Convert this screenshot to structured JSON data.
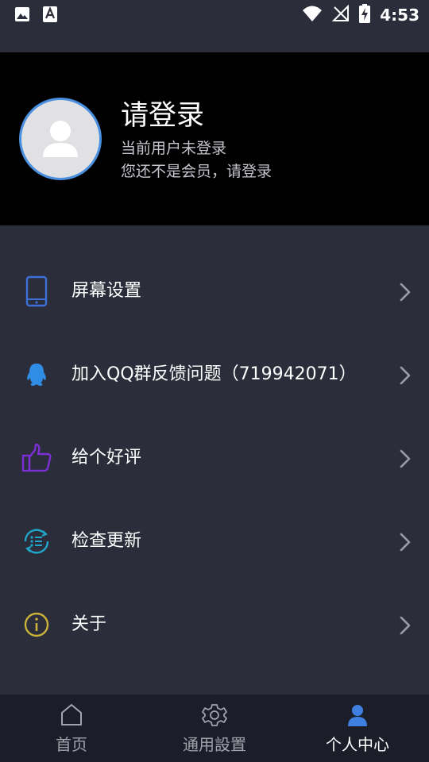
{
  "status_bar": {
    "time": "4:53",
    "left_icons": [
      "image-icon",
      "a-icon"
    ],
    "right_icons": [
      "wifi-icon",
      "no-signal-icon",
      "battery-charging-icon"
    ]
  },
  "profile": {
    "title": "请登录",
    "subtitle_1": "当前用户未登录",
    "subtitle_2": "您还不是会员，请登录"
  },
  "menu": {
    "items": [
      {
        "label": "屏幕设置",
        "icon": "phone-screen-icon",
        "icon_color": "#3d6fd9"
      },
      {
        "label": "加入QQ群反馈问题（719942071）",
        "icon": "qq-icon",
        "icon_color": "#2f8de6"
      },
      {
        "label": "给个好评",
        "icon": "thumbs-up-icon",
        "icon_color": "#7b2fd4"
      },
      {
        "label": "检查更新",
        "icon": "update-icon",
        "icon_color": "#1fa6c8"
      },
      {
        "label": "关于",
        "icon": "info-icon",
        "icon_color": "#c8b23a"
      }
    ]
  },
  "bottom_nav": {
    "items": [
      {
        "label": "首页",
        "icon": "home-icon",
        "active": false
      },
      {
        "label": "通用設置",
        "icon": "settings-gear-icon",
        "active": false
      },
      {
        "label": "个人中心",
        "icon": "user-icon",
        "active": true
      }
    ],
    "active_color": "#3f7fe0"
  },
  "colors": {
    "background": "#2b2d3a",
    "header": "#000000",
    "nav_bar": "#1b1d29",
    "avatar_ring": "#4a8fe0"
  }
}
